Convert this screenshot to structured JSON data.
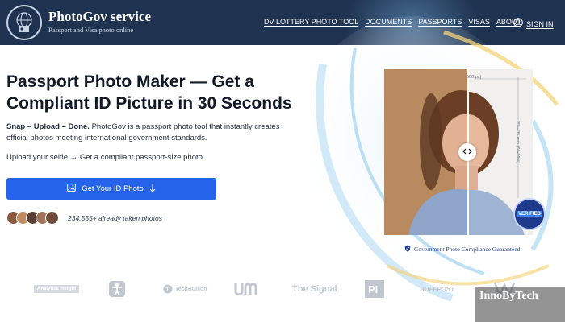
{
  "brand": {
    "name": "PhotoGov service",
    "tagline": "Passport and Visa photo online"
  },
  "nav": {
    "items": [
      {
        "label": "DV LOTTERY PHOTO TOOL"
      },
      {
        "label": "DOCUMENTS"
      },
      {
        "label": "PASSPORTS"
      },
      {
        "label": "VISAS"
      },
      {
        "label": "ABOUT"
      }
    ],
    "signin_label": "SIGN IN"
  },
  "hero": {
    "title_bold": "Passport Photo Maker",
    "title_rest": " — Get a Compliant ID Picture in 30 Seconds",
    "desc_bold": "Snap – Upload – Done.",
    "desc_rest": " PhotoGov is a passport photo tool that instantly creates official photos meeting international government standards.",
    "flow": "Upload your selfie → Get a compliant passport-size photo",
    "cta_label": "Get Your ID Photo",
    "social_proof": "234,555+ already taken photos"
  },
  "photo_panel": {
    "measure_top": "500 px)",
    "measure_side": "25 – 35 mm (50-69%)",
    "badge": "VERIFIED",
    "guarantee": "Government Photo Compliance Guaranteed"
  },
  "logos": [
    "Analytics Insight",
    "TechBullion",
    "The Signal",
    "HUFFPOST"
  ],
  "watermark": "InnoByTech",
  "colors": {
    "header_bg": "#1f3350",
    "cta_bg": "#2563eb",
    "verified_bg": "#1e3a8a"
  }
}
